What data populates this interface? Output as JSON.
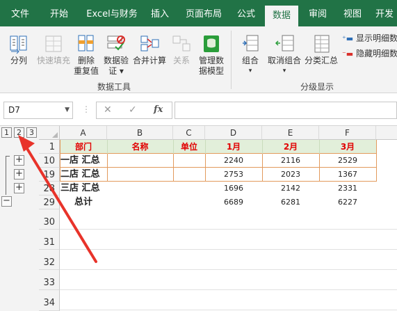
{
  "ribbon_tabs": [
    {
      "label": "文件",
      "active": false
    },
    {
      "label": "开始",
      "active": false
    },
    {
      "label": "Excel与财务",
      "active": false
    },
    {
      "label": "插入",
      "active": false
    },
    {
      "label": "页面布局",
      "active": false
    },
    {
      "label": "公式",
      "active": false
    },
    {
      "label": "数据",
      "active": true
    },
    {
      "label": "审阅",
      "active": false
    },
    {
      "label": "视图",
      "active": false
    },
    {
      "label": "开发",
      "active": false
    }
  ],
  "ribbon": {
    "data_tools": {
      "group_label": "数据工具",
      "split": "分列",
      "flash_fill": "快速填充",
      "remove_dup_1": "删除",
      "remove_dup_2": "重复值",
      "validate_1": "数据验",
      "validate_2": "证",
      "consolidate": "合并计算",
      "relations": "关系",
      "manage_1": "管理数",
      "manage_2": "据模型"
    },
    "outline": {
      "group_label": "分级显示",
      "group": "组合",
      "ungroup": "取消组合",
      "subtotal": "分类汇总",
      "show_detail": "显示明细数",
      "hide_detail": "隐藏明细数"
    }
  },
  "formula_bar": {
    "name_box": "D7",
    "cancel": "✕",
    "enter": "✓",
    "fx": "fx",
    "formula": ""
  },
  "outline_levels": [
    "1",
    "2",
    "3"
  ],
  "columns": [
    "A",
    "B",
    "C",
    "D",
    "E",
    "F"
  ],
  "rows": [
    "1",
    "10",
    "19",
    "28",
    "29",
    "30",
    "31",
    "32",
    "33",
    "34"
  ],
  "table": {
    "headers": [
      "部门",
      "名称",
      "单位",
      "1月",
      "2月",
      "3月"
    ],
    "body": [
      {
        "dept": "一店 汇总",
        "name": "",
        "unit": "",
        "m1": "2240",
        "m2": "2116",
        "m3": "2529"
      },
      {
        "dept": "二店 汇总",
        "name": "",
        "unit": "",
        "m1": "2753",
        "m2": "2023",
        "m3": "1367"
      },
      {
        "dept": "三店 汇总",
        "name": "",
        "unit": "",
        "m1": "1696",
        "m2": "2142",
        "m3": "2331"
      },
      {
        "dept": "总计",
        "name": "",
        "unit": "",
        "m1": "6689",
        "m2": "6281",
        "m3": "6227"
      }
    ]
  },
  "colors": {
    "excel_green": "#217346",
    "header_red": "#e10000",
    "header_fill": "#e2efda",
    "border_orange": "#e29a5c",
    "arrow_red": "#e8332a"
  },
  "icons": {
    "expand": "+",
    "collapse": "−"
  }
}
